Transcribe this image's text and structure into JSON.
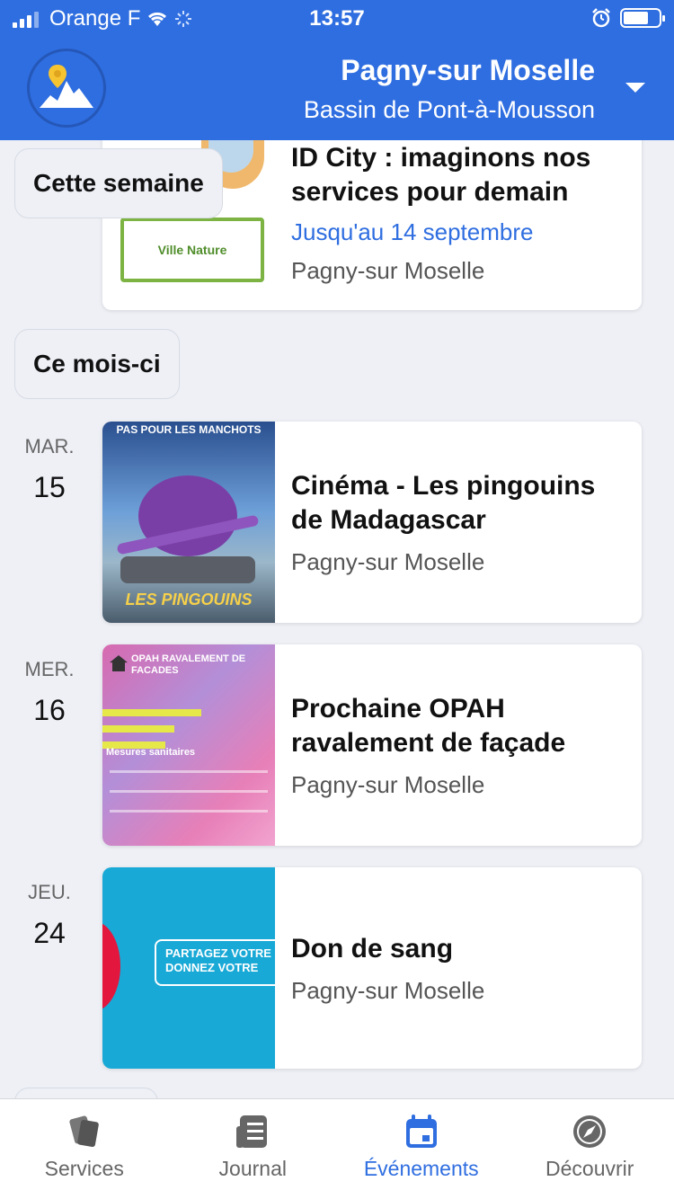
{
  "status_bar": {
    "carrier": "Orange F",
    "time": "13:57"
  },
  "header": {
    "city": "Pagny-sur Moselle",
    "region": "Bassin de Pont-à-Mousson"
  },
  "sections": {
    "this_week": "Cette semaine",
    "this_month": "Ce mois-ci"
  },
  "top_card": {
    "title": "ID City : imaginons nos services pour demain",
    "date": "Jusqu'au 14 septembre",
    "location": "Pagny-sur Moselle",
    "thumb_text": "Ville Nature"
  },
  "events": [
    {
      "dow": "MAR.",
      "day": "15",
      "title": "Cinéma - Les pingouins de Madagascar",
      "location": "Pagny-sur Moselle",
      "thumb_top": "PAS POUR LES MANCHOTS",
      "thumb_bottom": "LES PINGOUINS"
    },
    {
      "dow": "MER.",
      "day": "16",
      "title": "Prochaine OPAH ravalement de façade",
      "location": "Pagny-sur Moselle",
      "thumb_top": "OPAH RAVALEMENT DE FACADES",
      "thumb_bottom": "Mesures sanitaires"
    },
    {
      "dow": "JEU.",
      "day": "24",
      "title": "Don de sang",
      "location": "Pagny-sur Moselle",
      "thumb_top": "PARTAGEZ VOTRE",
      "thumb_bottom": "DONNEZ VOTRE"
    }
  ],
  "tabs": [
    {
      "label": "Services",
      "icon": "cards-icon"
    },
    {
      "label": "Journal",
      "icon": "newspaper-icon"
    },
    {
      "label": "Événements",
      "icon": "calendar-icon"
    },
    {
      "label": "Découvrir",
      "icon": "compass-icon"
    }
  ],
  "colors": {
    "primary": "#2f6ee0",
    "background": "#eef0f6"
  }
}
